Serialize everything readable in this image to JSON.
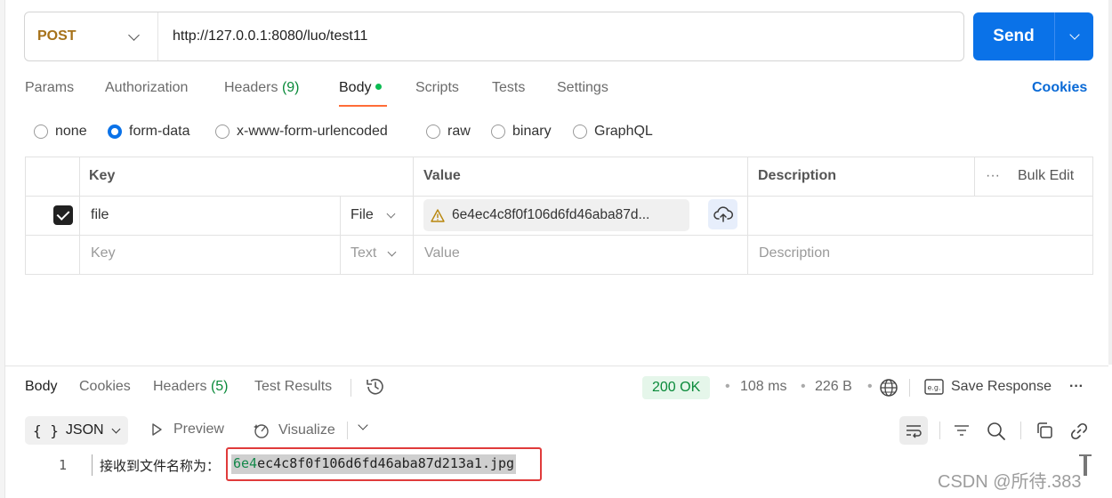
{
  "request": {
    "method": "POST",
    "url": "http://127.0.0.1:8080/luo/test11",
    "send_label": "Send",
    "tabs": [
      {
        "label": "Params"
      },
      {
        "label": "Authorization"
      },
      {
        "label": "Headers",
        "count": "(9)"
      },
      {
        "label": "Body"
      },
      {
        "label": "Scripts"
      },
      {
        "label": "Tests"
      },
      {
        "label": "Settings"
      }
    ],
    "cookies_label": "Cookies",
    "body_types": [
      "none",
      "form-data",
      "x-www-form-urlencoded",
      "raw",
      "binary",
      "GraphQL"
    ],
    "selected_body_type": "form-data"
  },
  "form_table": {
    "headers": {
      "key": "Key",
      "value": "Value",
      "description": "Description",
      "bulk_edit": "Bulk Edit"
    },
    "rows": [
      {
        "checked": true,
        "key": "file",
        "type": "File",
        "value": "6e4ec4c8f0f106d6fd46aba87d...",
        "description": ""
      }
    ],
    "empty_row": {
      "key": "Key",
      "type": "Text",
      "value": "Value",
      "description": "Description"
    }
  },
  "response": {
    "tabs": [
      {
        "label": "Body"
      },
      {
        "label": "Cookies"
      },
      {
        "label": "Headers",
        "count": "(5)"
      },
      {
        "label": "Test Results"
      }
    ],
    "status": "200 OK",
    "time": "108 ms",
    "size": "226 B",
    "save_label": "Save Response",
    "format": "JSON",
    "preview_label": "Preview",
    "visualize_label": "Visualize",
    "line_number": "1",
    "line_prefix": "接收到文件名称为：",
    "line_highlight_start": "6e4",
    "line_highlight_rest": "ec4c8f0f106d6fd46aba87d213a1.jpg"
  },
  "watermark": "CSDN @所待.383",
  "colors": {
    "accent": "#0a72e8",
    "method": "#a6721a",
    "status_ok": "#0a8a3a",
    "tab_underline": "#ff6c37",
    "highlight_border": "#e03b3b"
  }
}
